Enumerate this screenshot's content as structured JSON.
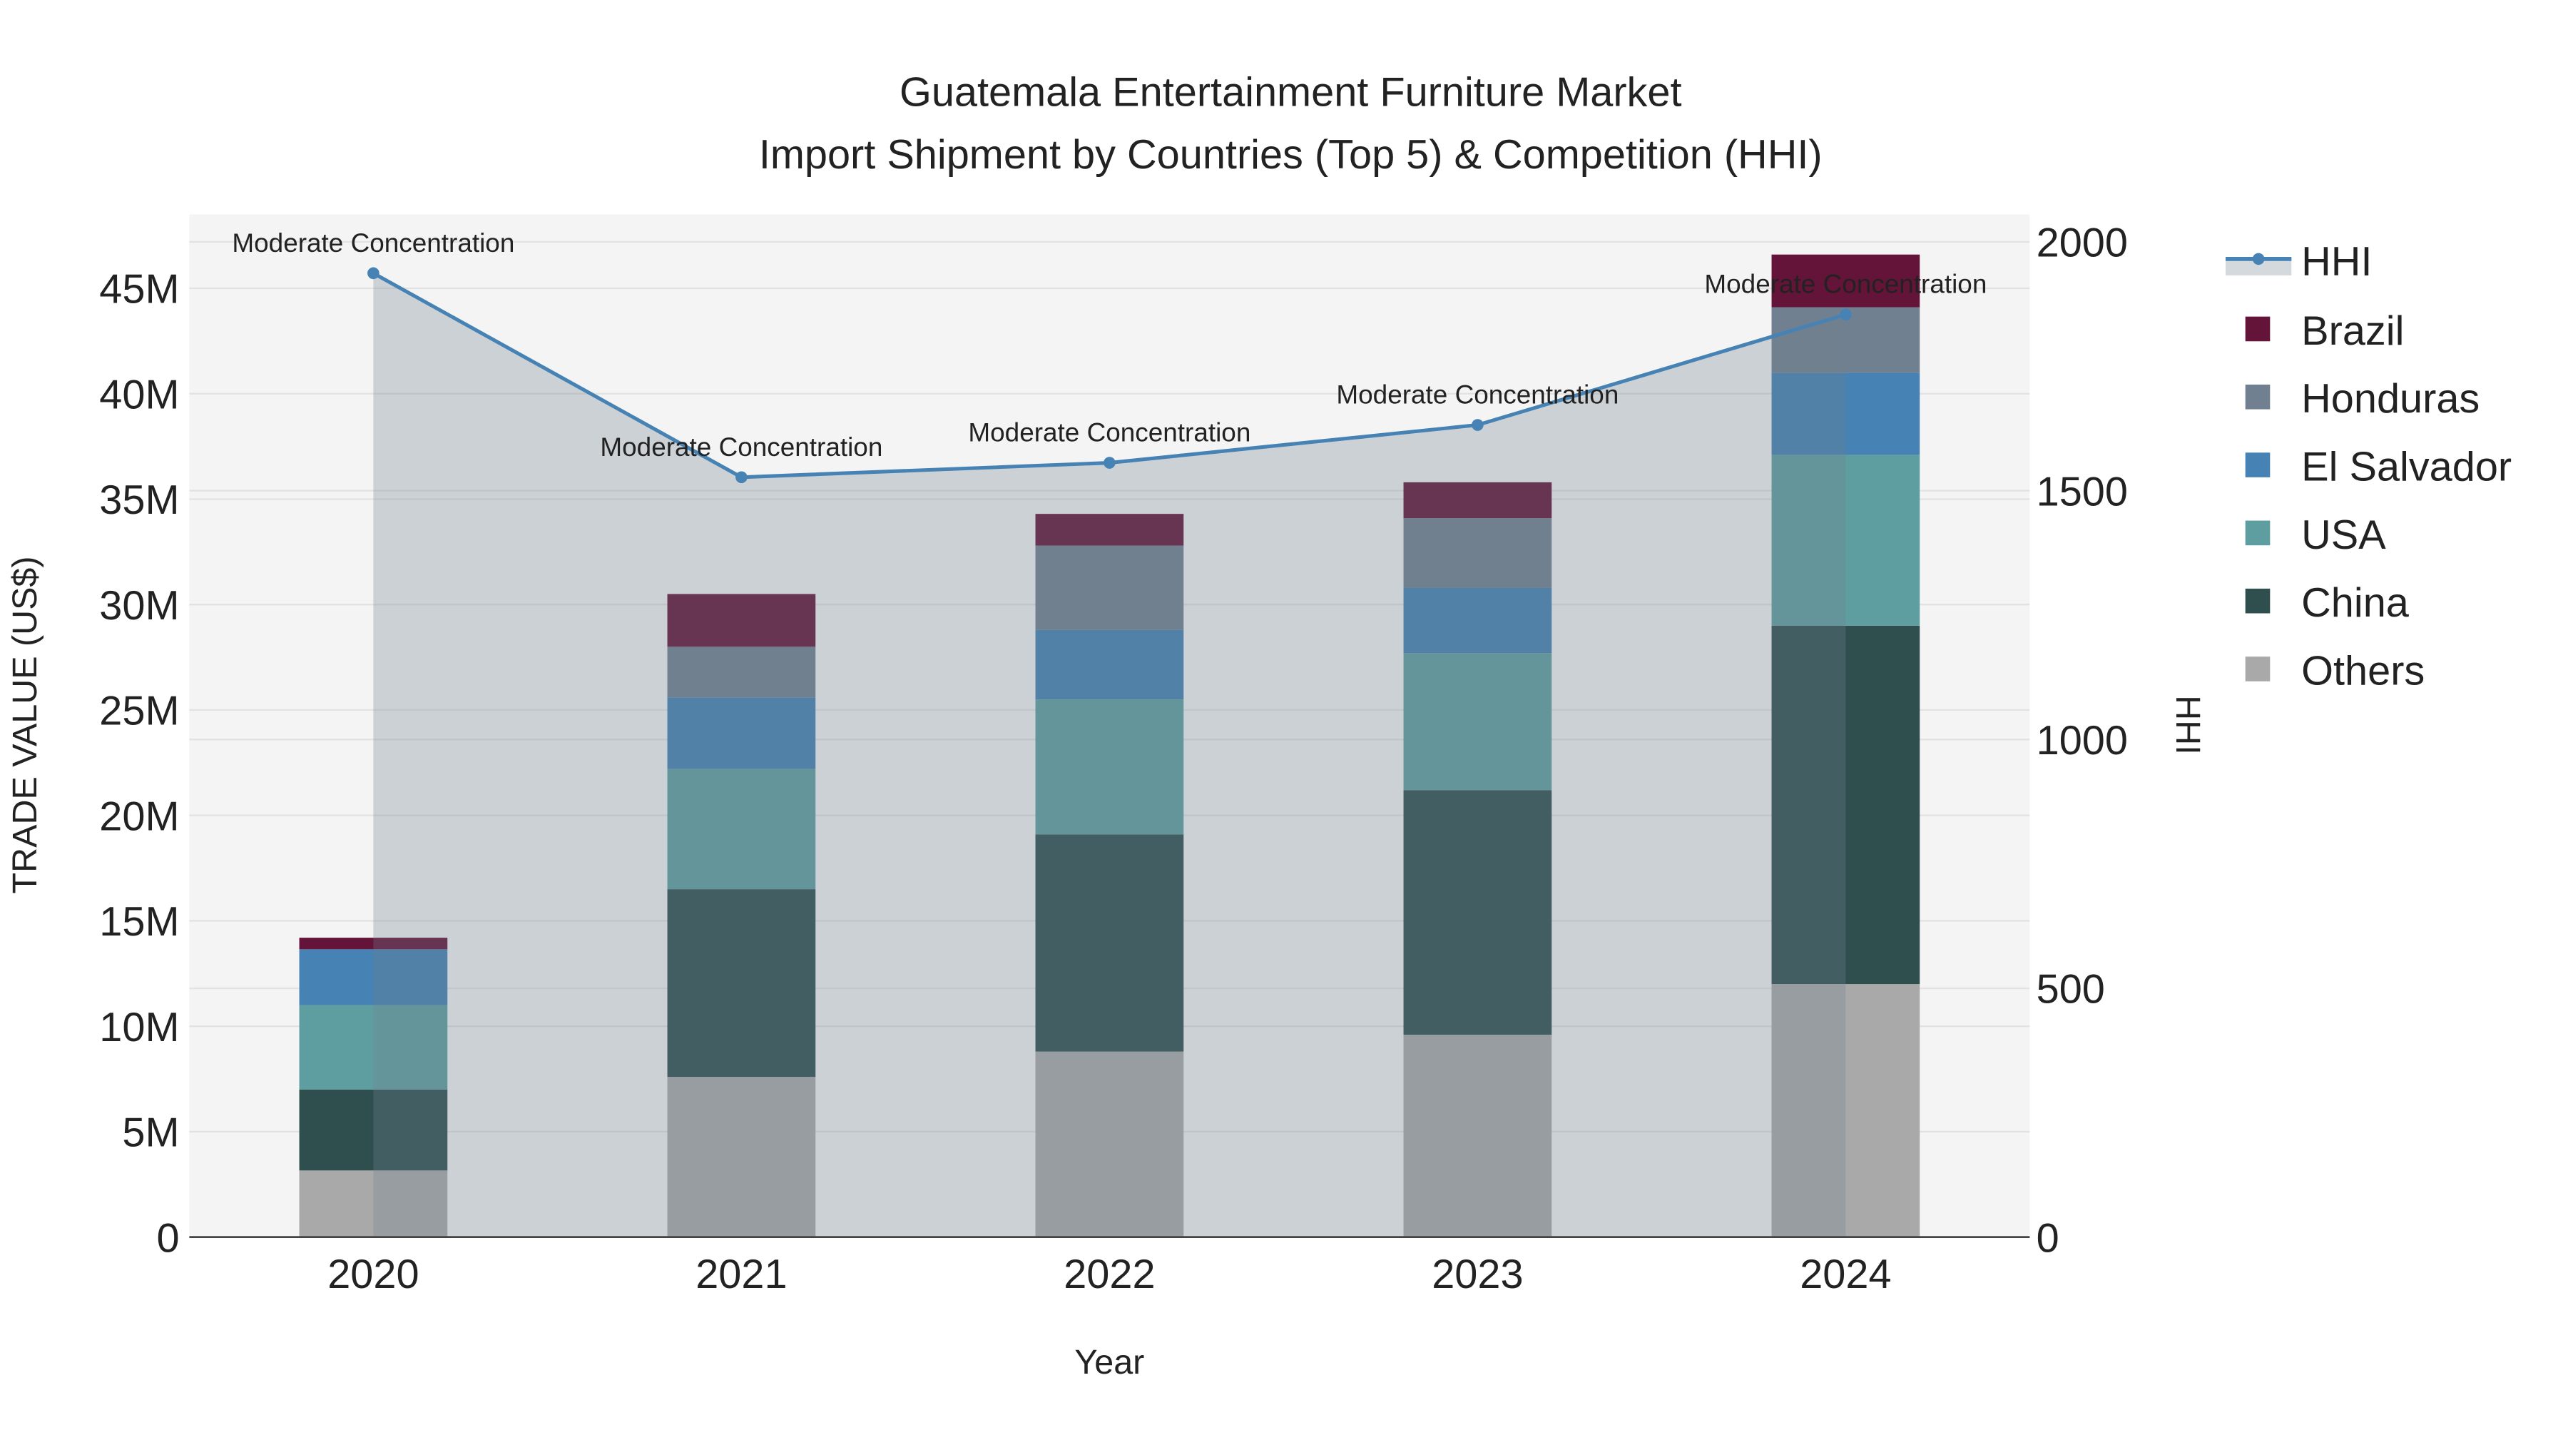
{
  "chart_data": {
    "type": "bar",
    "title_line1": "Guatemala Entertainment Furniture Market",
    "title_line2": "Import Shipment by Countries (Top 5) & Competition (HHI)",
    "xlabel": "Year",
    "ylabel": "TRADE VALUE (US$)",
    "y2label": "HHI",
    "categories": [
      "2020",
      "2021",
      "2022",
      "2023",
      "2024"
    ],
    "ylim": [
      0,
      48.5
    ],
    "y_unit": "M",
    "yticks": [
      0,
      5,
      10,
      15,
      20,
      25,
      30,
      35,
      40,
      45
    ],
    "ytick_labels": [
      "0",
      "5M",
      "10M",
      "15M",
      "20M",
      "25M",
      "30M",
      "35M",
      "40M",
      "45M"
    ],
    "y2lim": [
      0,
      2055
    ],
    "y2ticks": [
      0,
      500,
      1000,
      1500,
      2000
    ],
    "y2tick_labels": [
      "0",
      "500",
      "1000",
      "1500",
      "2000"
    ],
    "series": [
      {
        "name": "Others",
        "color": "#a9a9a9",
        "values": [
          3.16,
          7.6,
          8.8,
          9.6,
          12.0
        ]
      },
      {
        "name": "China",
        "color": "#2f4f4f",
        "values": [
          3.84,
          8.9,
          10.3,
          11.6,
          17.0
        ]
      },
      {
        "name": "USA",
        "color": "#5f9ea0",
        "values": [
          4.0,
          5.7,
          6.4,
          6.5,
          8.1
        ]
      },
      {
        "name": "El Salvador",
        "color": "#4682b4",
        "values": [
          2.65,
          3.4,
          3.3,
          3.1,
          3.9
        ]
      },
      {
        "name": "Honduras",
        "color": "#708090",
        "values": [
          0,
          2.4,
          4.0,
          3.3,
          3.1
        ]
      },
      {
        "name": "Brazil",
        "color": "#641438",
        "values": [
          0.55,
          2.5,
          1.5,
          1.7,
          2.5
        ]
      }
    ],
    "hhi": {
      "name": "HHI",
      "color": "#4682b4",
      "values": [
        1937,
        1527,
        1556,
        1632,
        1854
      ],
      "annotations": [
        "Moderate Concentration",
        "Moderate Concentration",
        "Moderate Concentration",
        "Moderate Concentration",
        "Moderate Concentration"
      ]
    },
    "legend": [
      "HHI",
      "Brazil",
      "Honduras",
      "El Salvador",
      "USA",
      "China",
      "Others"
    ],
    "legend_placement": "right",
    "grid": true
  }
}
